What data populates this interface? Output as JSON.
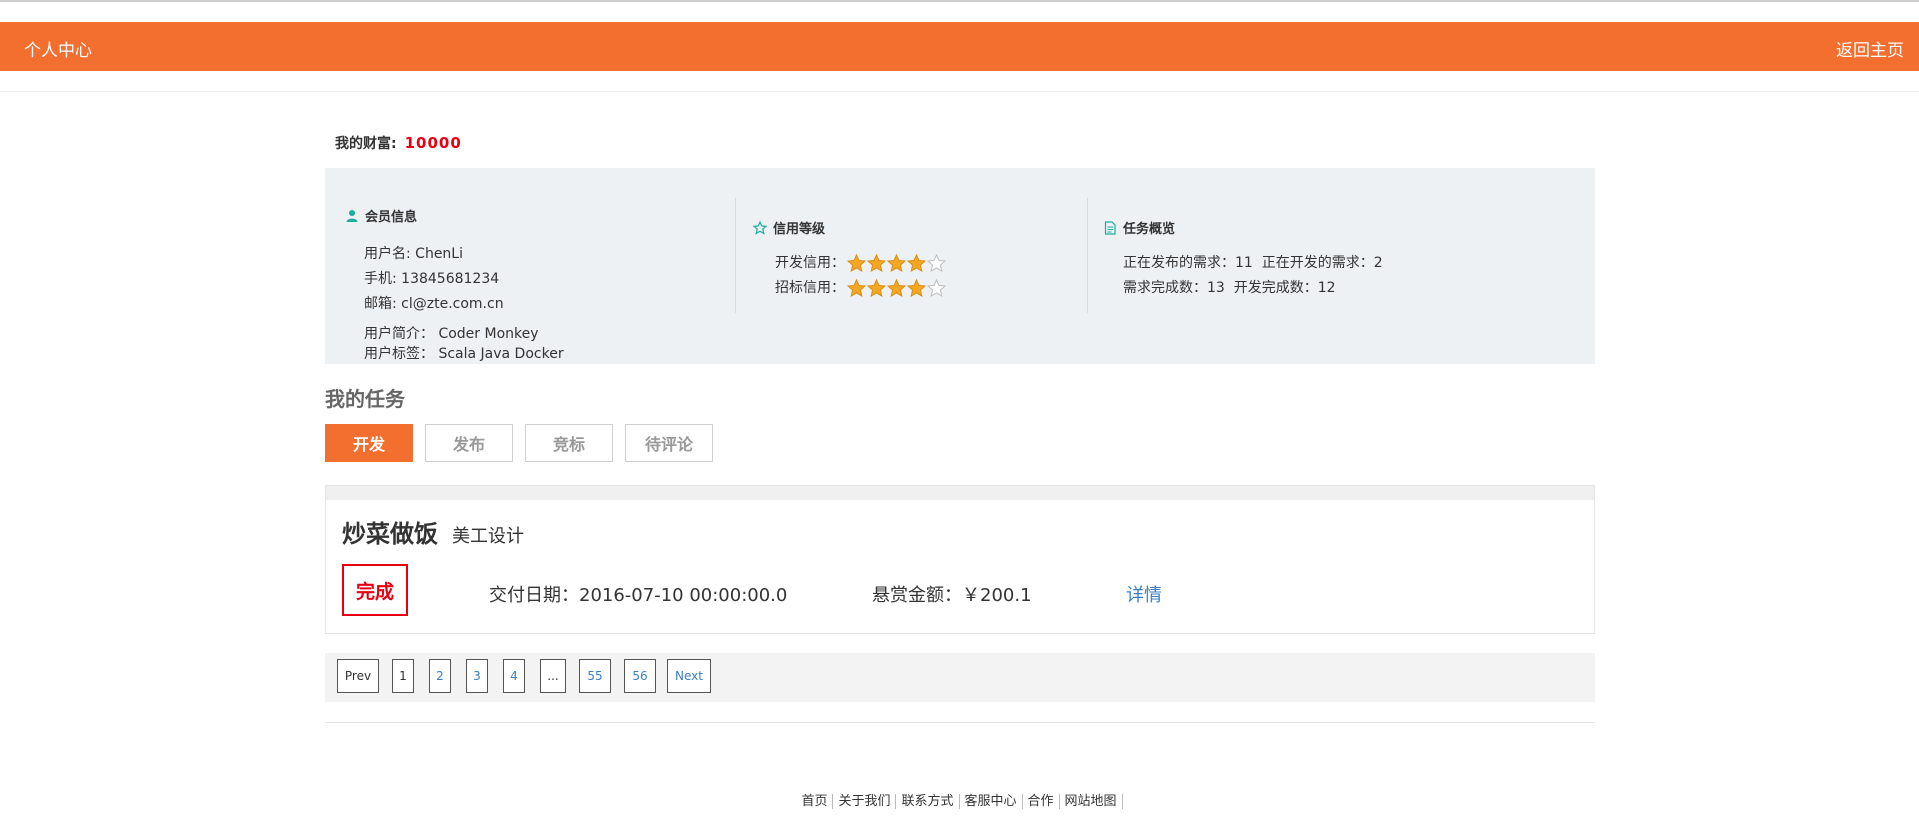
{
  "header": {
    "title": "个人中心",
    "home_link": "返回主页"
  },
  "wealth": {
    "label": "我的财富:",
    "value": "10000"
  },
  "member": {
    "title": "会员信息",
    "username": "用户名: ChenLi",
    "phone": "手机: 13845681234",
    "email": "邮箱: cl@zte.com.cn",
    "intro": "用户简介： Coder Monkey",
    "tags": "用户标签： Scala Java Docker"
  },
  "credit": {
    "title": "信用等级",
    "dev_label": "开发信用：",
    "dev_rating": 4,
    "bid_label": "招标信用：",
    "bid_rating": 4,
    "max_rating": 5
  },
  "overview": {
    "title": "任务概览",
    "line1": "正在发布的需求：11  正在开发的需求：2",
    "line2": "需求完成数：13  开发完成数：12"
  },
  "my_tasks": {
    "title": "我的任务",
    "tabs": [
      "开发",
      "发布",
      "竞标",
      "待评论"
    ],
    "active_tab": "开发"
  },
  "task": {
    "name": "炒菜做饭",
    "category": "美工设计",
    "status": "完成",
    "delivery": "交付日期：2016-07-10 00:00:00.0",
    "reward": "悬赏金额：￥200.1",
    "detail": "详情"
  },
  "pagination": {
    "prev": "Prev",
    "pages": [
      "1",
      "2",
      "3",
      "4",
      "...",
      "55",
      "56"
    ],
    "current": "1",
    "next": "Next"
  },
  "footer": {
    "links": [
      "首页",
      "关于我们",
      "联系方式",
      "客服中心",
      "合作",
      "网站地图"
    ]
  },
  "colors": {
    "brand": "#f36f30",
    "danger": "#e60012",
    "link": "#3a7fc4",
    "star": "#f5a623",
    "icon": "#1aaf9b"
  }
}
